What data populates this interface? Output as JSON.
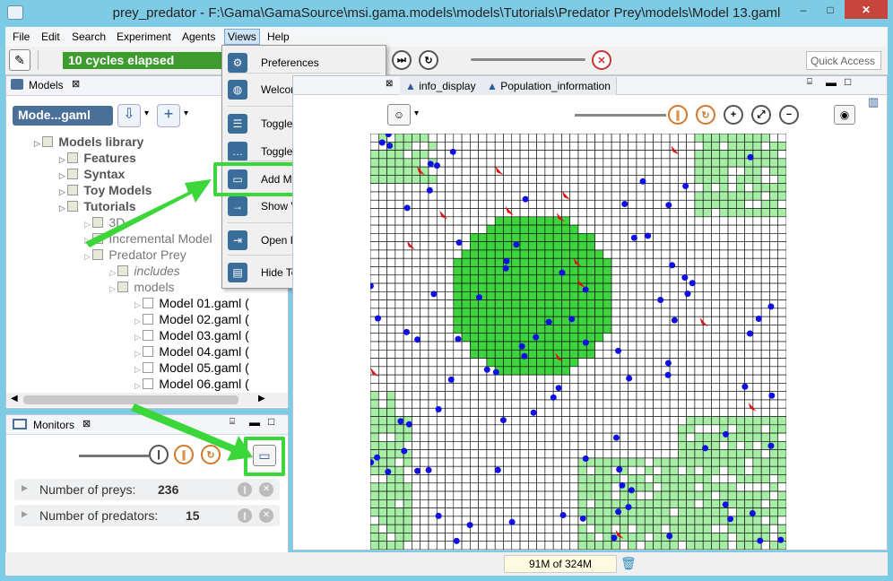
{
  "window": {
    "title": "prey_predator - F:\\Gama\\GamaSource\\msi.gama.models\\models\\Tutorials\\Predator Prey\\models\\Model 13.gaml",
    "minimize": "–",
    "maximize": "□",
    "close": "✕"
  },
  "menu": [
    "File",
    "Edit",
    "Search",
    "Experiment",
    "Agents",
    "Views",
    "Help"
  ],
  "toolbar": {
    "cycles": "10 cycles elapsed",
    "quick_access": "Quick Access"
  },
  "models_panel": {
    "title": "Models",
    "combo": "Mode...gaml",
    "tree": [
      {
        "label": "Models library",
        "level": 0,
        "style": "bold"
      },
      {
        "label": "Features",
        "level": 1,
        "style": "bold"
      },
      {
        "label": "Syntax",
        "level": 1,
        "style": "bold"
      },
      {
        "label": "Toy Models",
        "level": 1,
        "style": "bold"
      },
      {
        "label": "Tutorials",
        "level": 1,
        "style": "bold"
      },
      {
        "label": "3D",
        "level": 2,
        "style": "normal"
      },
      {
        "label": "Incremental Model",
        "level": 2,
        "style": "normal"
      },
      {
        "label": "Predator Prey",
        "level": 2,
        "style": "normal"
      },
      {
        "label": "includes",
        "level": 3,
        "style": "italic"
      },
      {
        "label": "models",
        "level": 3,
        "style": "normal"
      },
      {
        "label": "Model 01.gaml (",
        "level": 4,
        "style": "file"
      },
      {
        "label": "Model 02.gaml (",
        "level": 4,
        "style": "file"
      },
      {
        "label": "Model 03.gaml (",
        "level": 4,
        "style": "file"
      },
      {
        "label": "Model 04.gaml (",
        "level": 4,
        "style": "file"
      },
      {
        "label": "Model 05.gaml (",
        "level": 4,
        "style": "file"
      },
      {
        "label": "Model 06.gaml (",
        "level": 4,
        "style": "file"
      }
    ]
  },
  "monitors_panel": {
    "title": "Monitors",
    "monitors": [
      {
        "label": "Number of preys:",
        "value": "236"
      },
      {
        "label": "Number of predators:",
        "value": "15"
      }
    ]
  },
  "views_menu": {
    "items": [
      {
        "label": "Preferences",
        "icon": "gear-icon",
        "glyph": "⚙",
        "submenu": false
      },
      {
        "label": "Welcome page",
        "icon": "globe-icon",
        "glyph": "◍",
        "submenu": false
      },
      {
        "label": "Toggle Parameters",
        "icon": "sliders-icon",
        "glyph": "☰",
        "submenu": false
      },
      {
        "label": "Toggle Console",
        "icon": "speech-bubble-icon",
        "glyph": "…",
        "submenu": false
      },
      {
        "label": "Add Monitor",
        "icon": "monitor-icon",
        "glyph": "▭",
        "submenu": false
      },
      {
        "label": "Show View",
        "icon": "arrow-right-icon",
        "glyph": "→",
        "submenu": true
      },
      {
        "label": "Open Perspective",
        "icon": "perspective-icon",
        "glyph": "⇥",
        "submenu": true
      },
      {
        "label": "Hide Toolbar",
        "icon": "toolbar-icon",
        "glyph": "▤",
        "submenu": false
      }
    ]
  },
  "display_tabs": [
    "info_display",
    "Population_information"
  ],
  "status": {
    "memory": "91M of 324M"
  },
  "colors": {
    "accent_green": "#3e9b2d",
    "highlight": "#3ad63a",
    "prey": "#1010e0",
    "predator": "#e01010",
    "dark_grass": "#3fd33f",
    "light_grass": "#a6eea6"
  }
}
